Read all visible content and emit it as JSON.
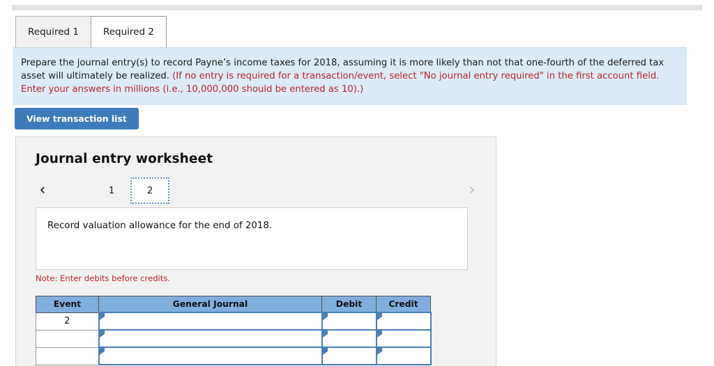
{
  "tabs": [
    {
      "label": "Required 1",
      "active": false
    },
    {
      "label": "Required 2",
      "active": true
    }
  ],
  "instruction": {
    "black_part": "Prepare the journal entry(s) to record Payne’s income taxes for 2018, assuming it is more likely than not that one-fourth of the deferred tax asset will ultimately be realized. ",
    "red_part": "(If no entry is required for a transaction/event, select \"No journal entry required\" in the first account field. Enter your answers in millions (i.e., 10,000,000 should be entered as 10).)"
  },
  "toolbar": {
    "view_transaction_list_label": "View transaction list"
  },
  "worksheet": {
    "title": "Journal entry worksheet",
    "pager": {
      "prev_icon": "‹",
      "next_icon": "›",
      "pages": [
        "1",
        "2"
      ],
      "selected_page": "2"
    },
    "description": "Record valuation allowance for the end of 2018.",
    "note": "Note: Enter debits before credits.",
    "table": {
      "columns": [
        "Event",
        "General Journal",
        "Debit",
        "Credit"
      ],
      "rows": [
        {
          "event": "2",
          "general_journal": "",
          "debit": "",
          "credit": ""
        },
        {
          "event": "",
          "general_journal": "",
          "debit": "",
          "credit": ""
        },
        {
          "event": "",
          "general_journal": "",
          "debit": "",
          "credit": ""
        }
      ]
    }
  },
  "colors": {
    "accent_blue": "#3d7cb9",
    "table_header_blue": "#82aede",
    "input_border_blue": "#4a7fb5",
    "instruction_bg": "#dcebf6",
    "warning_red": "#b8252c",
    "card_bg": "#f2f2f2"
  }
}
